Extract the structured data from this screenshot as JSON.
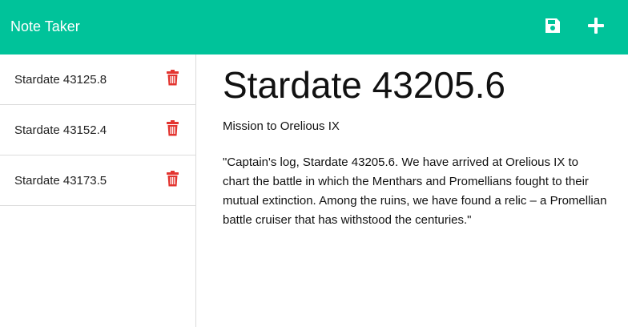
{
  "app": {
    "title": "Note Taker",
    "colors": {
      "navbar": "#00c39a",
      "delete_icon": "#e3342f"
    },
    "icons": {
      "save": "save-icon",
      "new": "plus-icon",
      "delete": "trash-icon"
    }
  },
  "sidebar": {
    "notes": [
      {
        "label": "Stardate 43125.8"
      },
      {
        "label": "Stardate 43152.4"
      },
      {
        "label": "Stardate 43173.5"
      }
    ]
  },
  "note": {
    "title": "Stardate 43205.6",
    "subtitle": "Mission to Orelious IX",
    "body": "\"Captain's log, Stardate 43205.6. We have arrived at Orelious IX to chart the battle in which the Menthars and Promellians fought to their mutual extinction. Among the ruins, we have found a relic – a Promellian battle cruiser that has withstood the centuries.\""
  }
}
